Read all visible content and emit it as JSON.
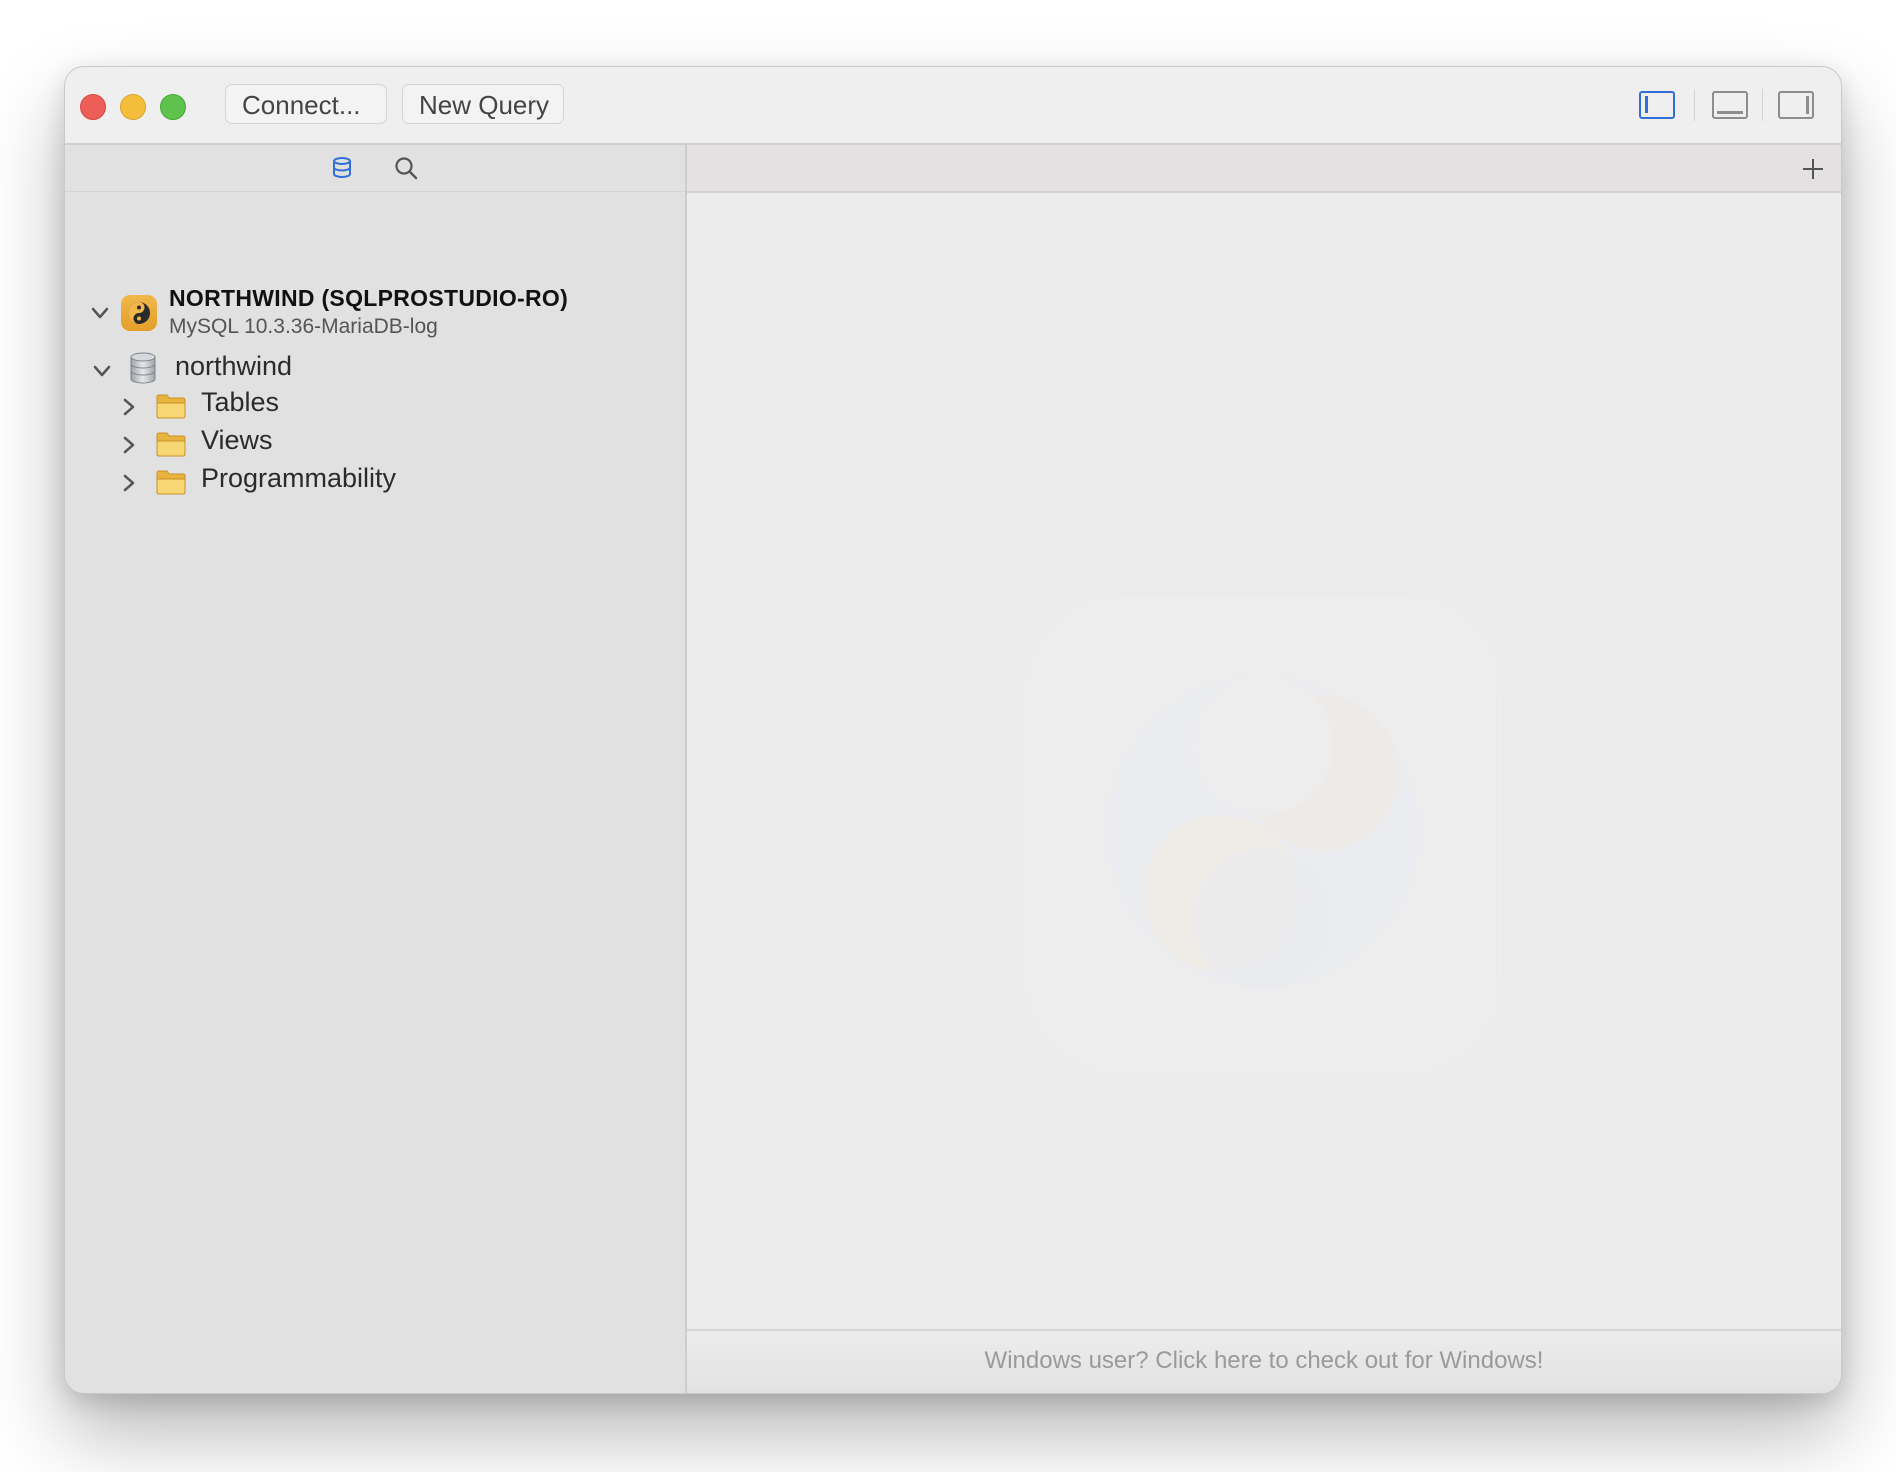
{
  "toolbar": {
    "connect_label": "Connect...",
    "new_query_label": "New Query",
    "layout_icons": [
      "sidebar-left-icon",
      "panel-bottom-icon",
      "sidebar-right-icon"
    ]
  },
  "sidebar": {
    "tabs": [
      "database-icon",
      "search-icon"
    ],
    "connection": {
      "title": "NORTHWIND (SQLPROSTUDIO-RO)",
      "subtitle": "MySQL 10.3.36-MariaDB-log"
    },
    "database": {
      "name": "northwind"
    },
    "folders": [
      {
        "label": "Tables"
      },
      {
        "label": "Views"
      },
      {
        "label": "Programmability"
      }
    ]
  },
  "main": {
    "footer_text": "Windows user? Click here to check out  for Windows!"
  },
  "colors": {
    "accent": "#2f6fd6",
    "close": "#ee5e58",
    "minimize": "#f4bd3c",
    "maximize": "#5ec24d",
    "folder": "#f3c85a"
  }
}
